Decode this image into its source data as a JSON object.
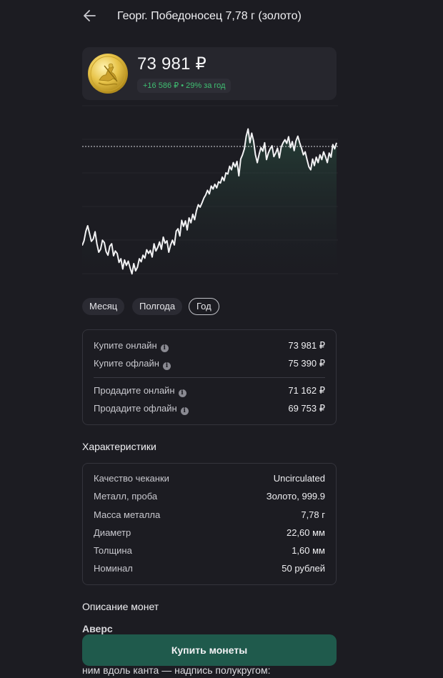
{
  "header": {
    "title": "Георг. Победоносец 7,78 г (золото)"
  },
  "price_card": {
    "price": "73 981 ₽",
    "change_amount": "+16 586 ₽",
    "change_percent": "29% за год"
  },
  "colors": {
    "accent_green": "#3fbf72",
    "button_green": "#1f5a4c",
    "background": "#1c1c22"
  },
  "chart_data": {
    "type": "line",
    "title": "",
    "xlabel": "",
    "ylabel": "",
    "reference_line": 73981,
    "ylim": [
      52000,
      81000
    ],
    "values": [
      57500,
      58300,
      59900,
      60800,
      59500,
      58200,
      58600,
      59800,
      57800,
      56400,
      56900,
      58400,
      58000,
      56500,
      55900,
      57400,
      57800,
      55800,
      56600,
      56200,
      54700,
      55300,
      53600,
      55100,
      54200,
      54900,
      53800,
      52800,
      54500,
      53300,
      53900,
      55300,
      54800,
      55900,
      55400,
      56800,
      56200,
      56700,
      55600,
      57800,
      56600,
      57200,
      58100,
      56900,
      58900,
      57900,
      58300,
      56400,
      57600,
      58400,
      57600,
      59900,
      60300,
      59100,
      61700,
      60700,
      61600,
      60100,
      62100,
      61300,
      62700,
      61800,
      63300,
      64300,
      63900,
      64600,
      65400,
      65900,
      66700,
      66100,
      67400,
      66900,
      67700,
      67100,
      68100,
      67900,
      68900,
      68300,
      69600,
      69400,
      70700,
      70100,
      71300,
      70600,
      71500,
      69100,
      71900,
      72600,
      73600,
      75700,
      76900,
      74600,
      76200,
      74900,
      72600,
      71300,
      72700,
      73800,
      73200,
      74600,
      71800,
      72900,
      73600,
      74100,
      72300,
      72900,
      73700,
      72100,
      73900,
      74600,
      75100,
      74500,
      75600,
      73800,
      74800,
      73300,
      74900,
      75700,
      74600,
      73700,
      72600,
      73100,
      71800,
      70600,
      70100,
      71900,
      70800,
      72200,
      71300,
      72600,
      71800,
      73100,
      72300,
      71300,
      72900,
      72200,
      74300,
      73600,
      74600
    ]
  },
  "periods": [
    "Месяц",
    "Полгода",
    "Год"
  ],
  "active_period": "Год",
  "prices": {
    "buy_online_label": "Купите онлайн",
    "buy_online_value": "73 981 ₽",
    "buy_offline_label": "Купите офлайн",
    "buy_offline_value": "75 390 ₽",
    "sell_online_label": "Продадите онлайн",
    "sell_online_value": "71 162 ₽",
    "sell_offline_label": "Продадите офлайн",
    "sell_offline_value": "69 753 ₽"
  },
  "characteristics": {
    "title": "Характеристики",
    "rows": [
      {
        "label": "Качество чеканки",
        "value": "Uncirculated"
      },
      {
        "label": "Металл, проба",
        "value": "Золото, 999.9"
      },
      {
        "label": "Масса металла",
        "value": "7,78 г"
      },
      {
        "label": "Диаметр",
        "value": "22,60 мм"
      },
      {
        "label": "Толщина",
        "value": "1,60 мм"
      },
      {
        "label": "Номинал",
        "value": "50 рублей"
      }
    ]
  },
  "description": {
    "title": "Описание монет",
    "subtitle": "Аверс",
    "text": "ним вдоль канта — надпись полукругом:"
  },
  "buy_button": "Купить монеты"
}
